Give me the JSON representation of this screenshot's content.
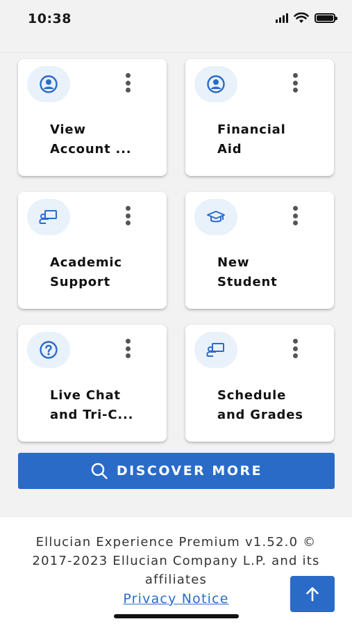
{
  "status_bar": {
    "time": "10:38"
  },
  "cards": [
    {
      "line1": "View",
      "line2": "Account ...",
      "icon": "user-circle-icon"
    },
    {
      "line1": "Financial",
      "line2": "Aid",
      "icon": "user-circle-icon"
    },
    {
      "line1": "Academic",
      "line2": "Support",
      "icon": "teacher-board-icon"
    },
    {
      "line1": "New",
      "line2": "Student",
      "icon": "graduation-cap-icon"
    },
    {
      "line1": "Live Chat",
      "line2": "and Tri-C...",
      "icon": "help-circle-icon"
    },
    {
      "line1": "Schedule",
      "line2": "and Grades",
      "icon": "teacher-board-icon"
    }
  ],
  "discover": {
    "label": "DISCOVER MORE",
    "icon": "search-icon"
  },
  "footer": {
    "line1": "Ellucian Experience Premium v1.52.0 ©",
    "line2": "2017-2023 Ellucian Company L.P. and its",
    "line3": "affiliates",
    "privacy_link": "Privacy Notice"
  },
  "colors": {
    "accent": "#2a6bc8",
    "icon_bg": "#e9f1fa",
    "icon_fg": "#2a6bc8",
    "page_bg": "#f2f2f2"
  }
}
